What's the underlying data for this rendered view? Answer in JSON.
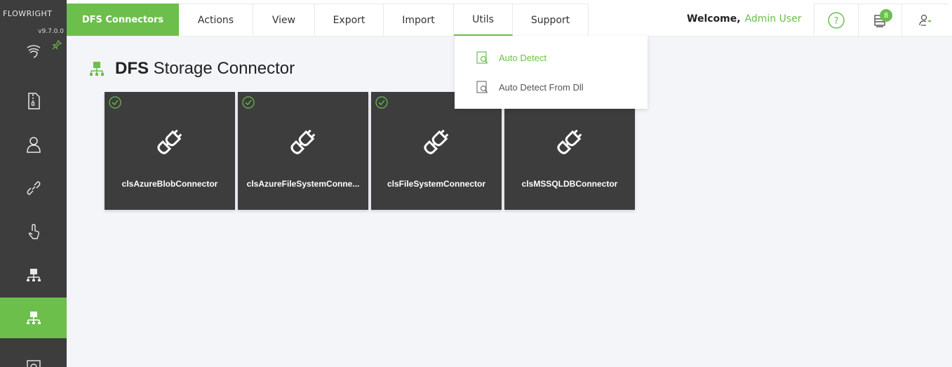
{
  "app": {
    "logo_text": "FLOWRIGHT",
    "version": "v9.7.0.0"
  },
  "colors": {
    "accent": "#6cbf4b",
    "sidebar": "#3d3d3d",
    "card": "#3d3d3d"
  },
  "topnav": {
    "brand_tab": "DFS Connectors",
    "tabs": [
      "Actions",
      "View",
      "Export",
      "Import",
      "Utils",
      "Support"
    ],
    "welcome_label": "Welcome,",
    "user_name": "Admin User",
    "notification_count": "8"
  },
  "utils_menu": {
    "items": [
      "Auto Detect",
      "Auto Detect From Dll"
    ]
  },
  "page": {
    "title_bold": "DFS",
    "title_rest": " Storage Connector"
  },
  "connectors": [
    {
      "name": "clsAzureBlobConnector"
    },
    {
      "name": "clsAzureFileSystemConne..."
    },
    {
      "name": "clsFileSystemConnector"
    },
    {
      "name": "clsMSSQLDBConnector"
    }
  ]
}
